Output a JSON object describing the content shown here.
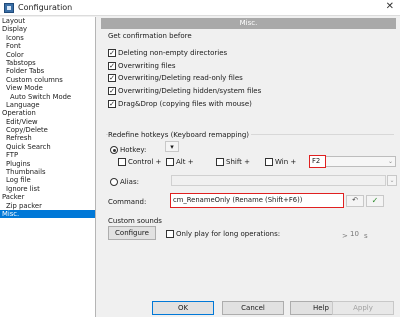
{
  "window": {
    "title": "Configuration",
    "close_glyph": "✕"
  },
  "tree": {
    "items": [
      {
        "label": "Layout",
        "level": 0
      },
      {
        "label": "Display",
        "level": 0
      },
      {
        "label": "Icons",
        "level": 1
      },
      {
        "label": "Font",
        "level": 1
      },
      {
        "label": "Color",
        "level": 1
      },
      {
        "label": "Tabstops",
        "level": 1
      },
      {
        "label": "Folder Tabs",
        "level": 1
      },
      {
        "label": "Custom columns",
        "level": 1
      },
      {
        "label": "View Mode",
        "level": 1
      },
      {
        "label": "Auto Switch Mode",
        "level": 2
      },
      {
        "label": "Language",
        "level": 1
      },
      {
        "label": "Operation",
        "level": 0
      },
      {
        "label": "Edit/View",
        "level": 1
      },
      {
        "label": "Copy/Delete",
        "level": 1
      },
      {
        "label": "Refresh",
        "level": 1
      },
      {
        "label": "Quick Search",
        "level": 1
      },
      {
        "label": "FTP",
        "level": 1
      },
      {
        "label": "Plugins",
        "level": 1
      },
      {
        "label": "Thumbnails",
        "level": 1
      },
      {
        "label": "Log file",
        "level": 1
      },
      {
        "label": "Ignore list",
        "level": 1
      },
      {
        "label": "Packer",
        "level": 0
      },
      {
        "label": "Zip packer",
        "level": 1
      },
      {
        "label": "Misc.",
        "level": 0,
        "selected": true
      }
    ]
  },
  "panel": {
    "header": "Misc.",
    "confirm_title": "Get confirmation before",
    "confirm": [
      {
        "label": "Deleting non-empty directories",
        "checked": true
      },
      {
        "label": "Overwriting files",
        "checked": true
      },
      {
        "label": "Overwriting/Deleting read-only files",
        "checked": true
      },
      {
        "label": "Overwriting/Deleting hidden/system files",
        "checked": true
      },
      {
        "label": "Drag&Drop (copying files with mouse)",
        "checked": true
      }
    ],
    "hotkeys_title": "Redefine hotkeys (Keyboard remapping)",
    "hotkey_label": "Hotkey:",
    "hotkey_button": "▾",
    "modifiers": {
      "control": "Control +",
      "alt": "Alt +",
      "shift": "Shift +",
      "win": "Win +"
    },
    "key_value": "F2",
    "alias_label": "Alias:",
    "command_label": "Command:",
    "command_value": "cm_RenameOnly (Rename (Shift+F6))",
    "custom_sounds_title": "Custom sounds",
    "configure_button": "Configure",
    "only_play_label": "Only play for long operations:",
    "long_ops_prefix": ">",
    "long_ops_value": "10",
    "long_ops_unit": "s"
  },
  "footer": {
    "ok": "OK",
    "cancel": "Cancel",
    "help": "Help",
    "apply": "Apply"
  },
  "colors": {
    "selection": "#0078d7",
    "header_bg": "#a9a9a9",
    "highlight_border": "#e02020"
  }
}
